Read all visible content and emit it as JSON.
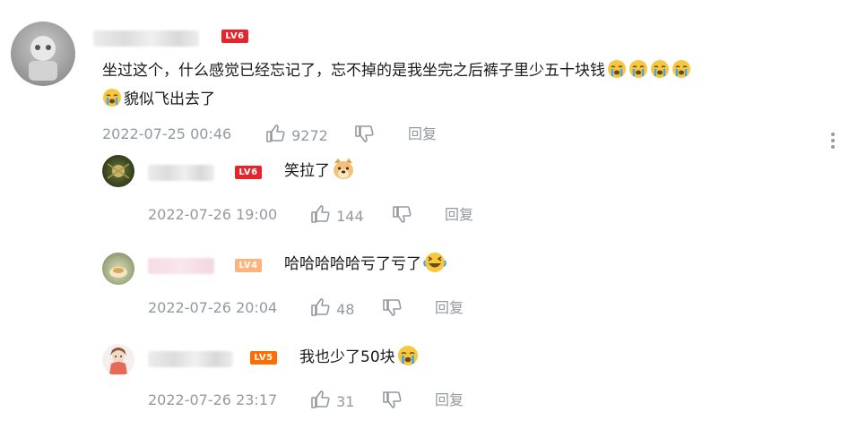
{
  "main_comment": {
    "username": "",
    "level": "LV6",
    "level_color": "#e5242b",
    "text_line1": "坐过这个，什么感觉已经忘记了，忘不掉的是我坐完之后裤子里少五十块钱",
    "text_line2": "貌似飞出去了",
    "time": "2022-07-25 00:46",
    "likes": "9272",
    "reply_label": "回复"
  },
  "replies": [
    {
      "username": "",
      "level": "LV6",
      "level_color": "#e5242b",
      "text": "笑拉了",
      "time": "2022-07-26 19:00",
      "likes": "144",
      "reply_label": "回复"
    },
    {
      "username": "",
      "level": "LV4",
      "level_color": "#ffb37c",
      "text": "哈哈哈哈哈亏了亏了",
      "time": "2022-07-26 20:04",
      "likes": "48",
      "reply_label": "回复"
    },
    {
      "username": "",
      "level": "LV5",
      "level_color": "#ff6c00",
      "text": "我也少了50块",
      "time": "2022-07-26 23:17",
      "likes": "31",
      "reply_label": "回复"
    }
  ],
  "icons": {
    "like": "thumbs-up-icon",
    "dislike": "thumbs-down-icon",
    "more": "more-vertical-icon",
    "emoji_cry": "crying-emoji-icon",
    "emoji_doge": "doge-emoji-icon",
    "emoji_laugh": "laughing-emoji-icon"
  }
}
